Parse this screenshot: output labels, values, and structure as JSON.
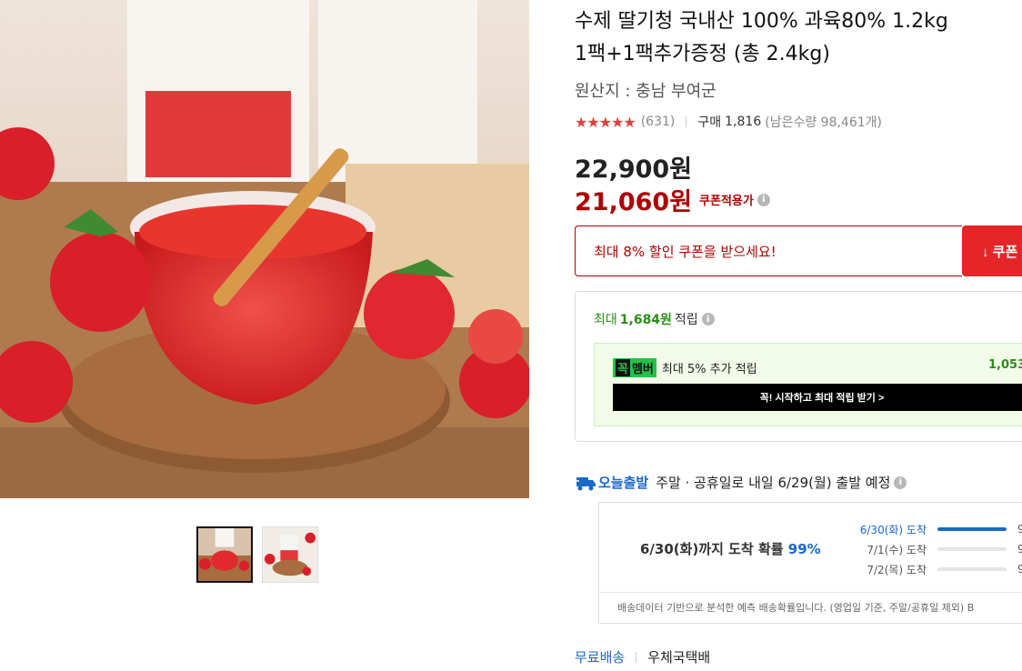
{
  "product": {
    "title_line1": "수제 딸기청 국내산 100% 과육80% 1.2kg",
    "title_line2": "1팩+1팩추가증정 (총 2.4kg)",
    "origin": "원산지 : 충남 부여군",
    "rating": 4.5,
    "stars_text": "★★★★★",
    "rating_count": "(631)",
    "purchase_label": "구매",
    "purchase_count": "1,816",
    "remaining": "(남은수량 98,461개)"
  },
  "price": {
    "original": "22,900원",
    "sale": "21,060원",
    "coupon_tag": "쿠폰적용가",
    "info_icon": "i"
  },
  "coupon": {
    "message": "최대 8% 할인 쿠폰을 받으세요!",
    "button_label": "↓ 쿠폰"
  },
  "reward": {
    "label_pre": "최대",
    "amount": "1,684원",
    "label_post": "적립",
    "member_badge_k": "꼭",
    "member_badge_text": "멤버",
    "member_text": "최대 5% 추가 적립",
    "member_amount": "1,053",
    "member_cta": "꼭! 시작하고 최대 적립 받기 >"
  },
  "shipping": {
    "label": "오늘출발",
    "detail": "주말 · 공휴일로 내일 6/29(월) 출발 예정",
    "probability_main": "6/30(화)까지 도착 확률",
    "probability_pct": "99%",
    "items": [
      {
        "date": "6/30(화) 도착",
        "value": "9",
        "fill": 1.0,
        "active": true
      },
      {
        "date": "7/1(수) 도착",
        "value": "9",
        "fill": 0.0,
        "active": false
      },
      {
        "date": "7/2(목) 도착",
        "value": "9",
        "fill": 0.0,
        "active": false
      }
    ],
    "note": "배송데이터 기반으로 분석한 예측 배송확률입니다. (영업일 기준, 주말/공휴일 제외) B",
    "free_label": "무료배송",
    "courier": "우체국택배"
  },
  "colors": {
    "sale_red": "#ae0000",
    "coupon_button": "#e52528",
    "reward_green": "#2c8c19",
    "ship_blue": "#1a68c8"
  },
  "icons": {
    "truck": "truck-icon",
    "info": "info-icon",
    "download": "download-icon"
  }
}
